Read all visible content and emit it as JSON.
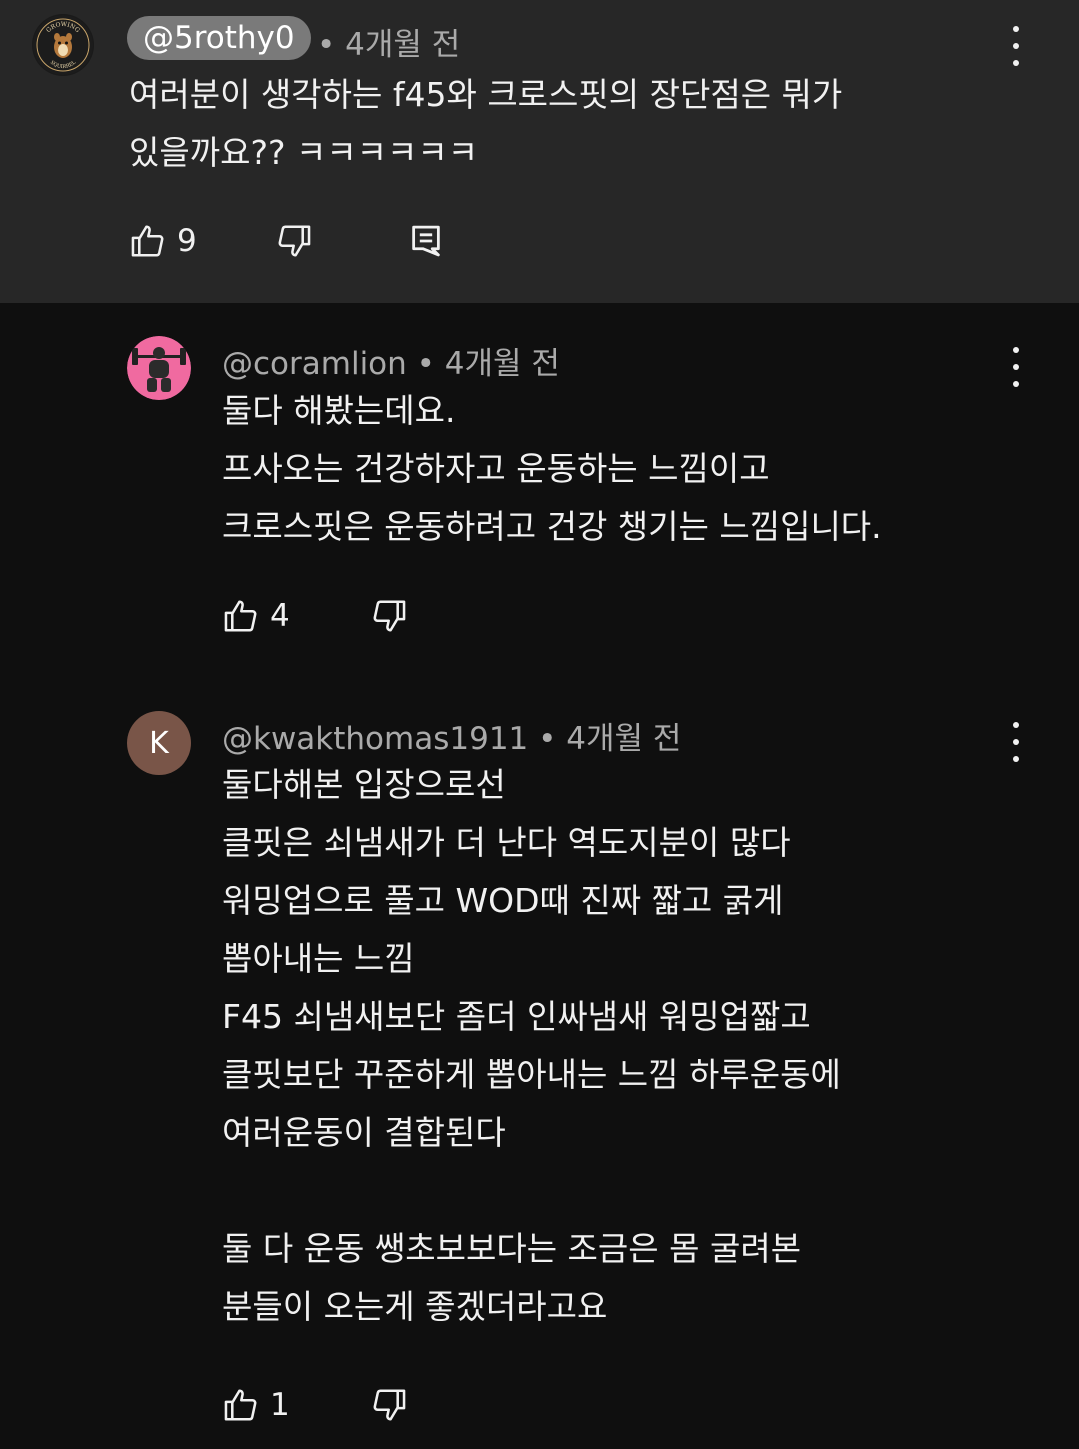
{
  "comments": [
    {
      "handle": "@5rothy0",
      "time": "• 4개월 전",
      "text": "여러분이 생각하는 f45와 크로스핏의 장단점은 뭐가\n있을까요?? ㅋㅋㅋㅋㅋㅋ",
      "likes": "9",
      "avatar_icon": "growing-squirrel-logo",
      "avatar_logo_text_top": "GROWING",
      "avatar_logo_text_bottom": "SQUIRREL"
    },
    {
      "handle": "@coramlion",
      "time": "• 4개월 전",
      "text": "둘다 해봤는데요.\n프사오는 건강하자고 운동하는 느낌이고\n크로스핏은 운동하려고 건강 챙기는 느낌입니다.",
      "likes": "4",
      "avatar_icon": "lifter-avatar"
    },
    {
      "handle": "@kwakthomas1911",
      "time": "• 4개월 전",
      "text": "둘다해본 입장으로선\n클핏은 쇠냄새가 더 난다 역도지분이 많다\n워밍업으로 풀고 WOD때 진짜 짧고 굵게\n뽑아내는 느낌\nF45 쇠냄새보단 좀더 인싸냄새 워밍업짧고\n클핏보단 꾸준하게 뽑아내는 느낌 하루운동에\n여러운동이 결합된다\n\n둘 다 운동 쌩초보보다는 조금은 몸 굴려본\n분들이 오는게 좋겠더라고요",
      "likes": "1",
      "avatar_letter": "K"
    }
  ],
  "colors": {
    "background": "#0f0f0f",
    "highlight_background": "#272727",
    "text_primary": "#f1f1f1",
    "text_secondary": "#aaaaaa",
    "pill": "#7a7a7a",
    "avatar_k": "#795548",
    "avatar_pink": "#f06aa0"
  }
}
